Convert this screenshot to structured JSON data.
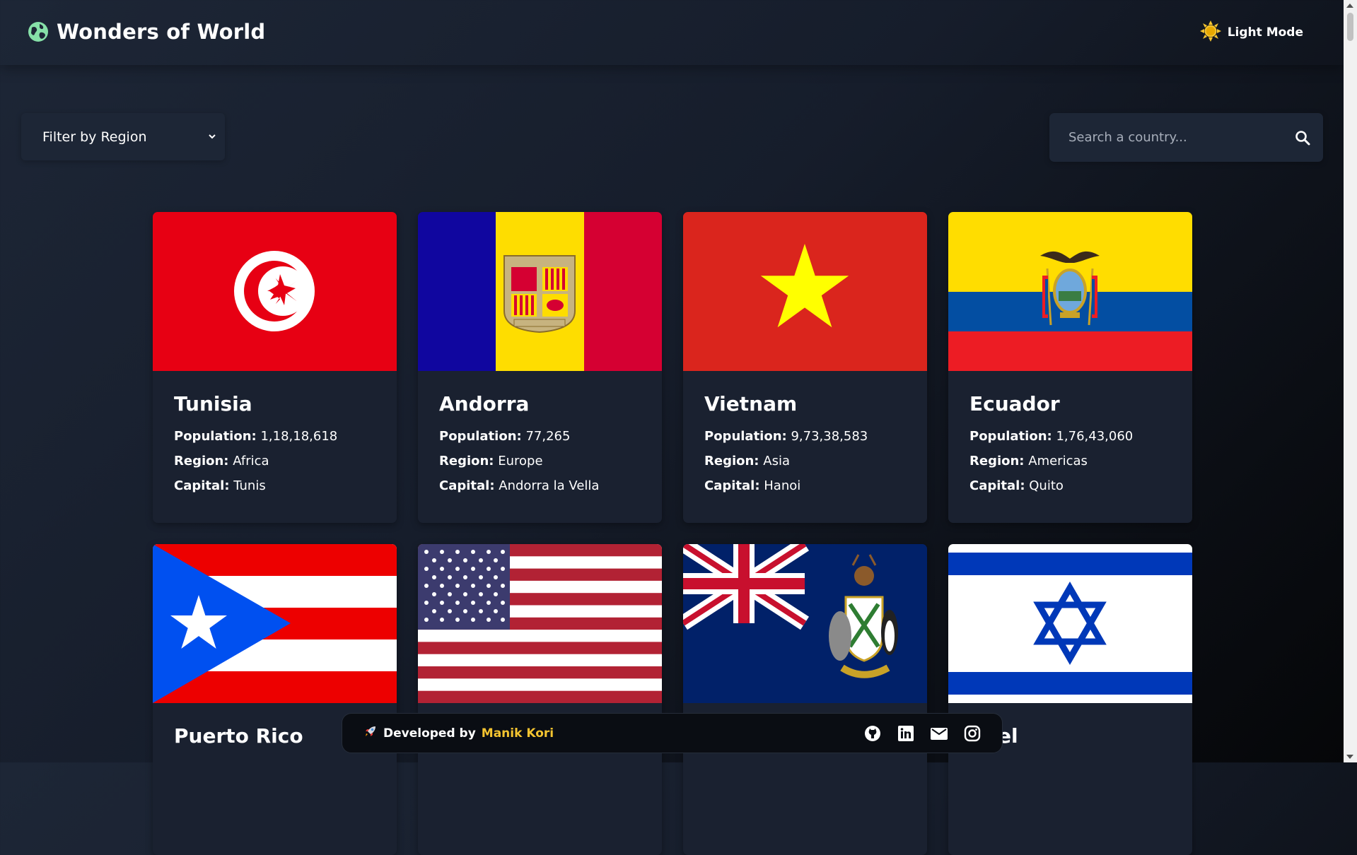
{
  "header": {
    "title": "Wonders of World",
    "logo_icon": "earth-globe-icon",
    "theme_toggle_label": "Light Mode",
    "theme_icon": "sun-icon"
  },
  "filter": {
    "label": "Filter by Region",
    "icon": "chevron-down-icon"
  },
  "search": {
    "placeholder": "Search a country...",
    "icon": "search-icon"
  },
  "labels": {
    "population": "Population:",
    "region": "Region:",
    "capital": "Capital:"
  },
  "countries": [
    {
      "name": "Tunisia",
      "population": "1,18,18,618",
      "region": "Africa",
      "capital": "Tunis"
    },
    {
      "name": "Andorra",
      "population": "77,265",
      "region": "Europe",
      "capital": "Andorra la Vella"
    },
    {
      "name": "Vietnam",
      "population": "9,73,38,583",
      "region": "Asia",
      "capital": "Hanoi"
    },
    {
      "name": "Ecuador",
      "population": "1,76,43,060",
      "region": "Americas",
      "capital": "Quito"
    },
    {
      "name": "Puerto Rico"
    },
    {
      "name": ""
    },
    {
      "name": ""
    },
    {
      "name": "el"
    }
  ],
  "footer": {
    "icon": "rocket-icon",
    "developed_by": "Developed by",
    "developer_name": "Manik Kori",
    "social_icons": [
      "github-icon",
      "linkedin-icon",
      "mail-icon",
      "instagram-icon"
    ]
  },
  "colors": {
    "background": "#161d2b",
    "card": "#1a2130",
    "accent": "#f4c430",
    "logo": "#86e0a8"
  }
}
